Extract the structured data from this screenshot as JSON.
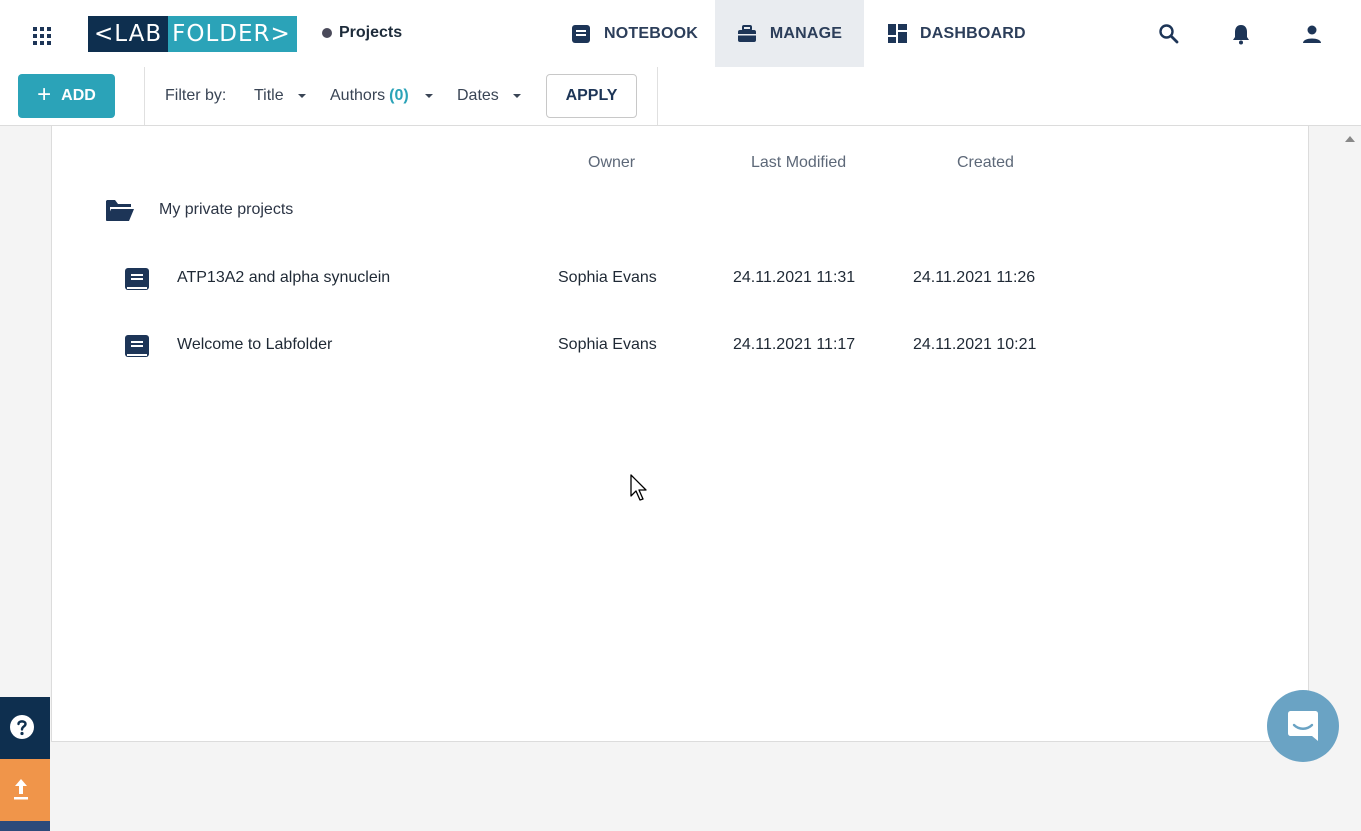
{
  "app": {
    "logo_left": "<LAB",
    "logo_right": "FOLDER>",
    "breadcrumb": "Projects"
  },
  "nav": {
    "notebook": "NOTEBOOK",
    "manage": "MANAGE",
    "dashboard": "DASHBOARD",
    "active": "manage"
  },
  "toolbar": {
    "add_label": "ADD",
    "filter_by": "Filter by:",
    "title_filter": "Title",
    "authors_filter": "Authors",
    "authors_count": "(0)",
    "dates_filter": "Dates",
    "apply_label": "APPLY"
  },
  "table": {
    "columns": {
      "owner": "Owner",
      "last_modified": "Last Modified",
      "created": "Created"
    },
    "folder": {
      "name": "My private projects"
    },
    "rows": [
      {
        "title": "ATP13A2 and alpha synuclein",
        "owner": "Sophia Evans",
        "last_modified": "24.11.2021 11:31",
        "created": "24.11.2021 11:26"
      },
      {
        "title": "Welcome to Labfolder",
        "owner": "Sophia Evans",
        "last_modified": "24.11.2021 11:17",
        "created": "24.11.2021 10:21"
      }
    ]
  },
  "icons": {
    "apps": "apps-grid-icon",
    "notebook": "notebook-icon",
    "manage": "briefcase-icon",
    "dashboard": "dashboard-icon",
    "search": "search-icon",
    "notifications": "bell-icon",
    "account": "user-icon",
    "folder": "folder-open-icon",
    "project": "notebook-icon",
    "help": "help-icon",
    "upload": "upload-icon",
    "chat": "chat-icon"
  },
  "colors": {
    "brand_dark": "#0e2f4f",
    "brand_teal": "#2ba3b8",
    "upload_orange": "#f0954a",
    "chat_blue": "#6aa3c4"
  }
}
